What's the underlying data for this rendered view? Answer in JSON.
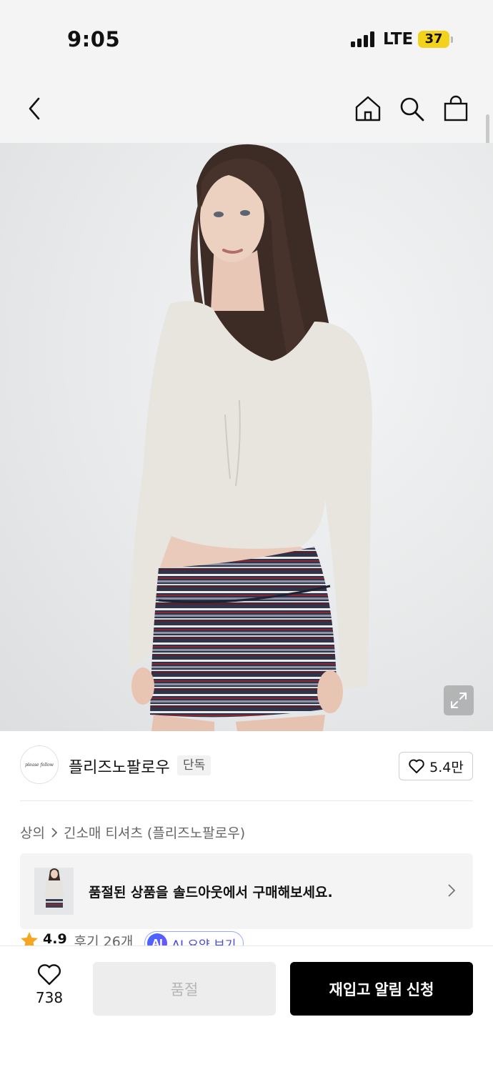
{
  "status_bar": {
    "time": "9:05",
    "network": "LTE",
    "battery": "37",
    "battery_color": "#f2d21b"
  },
  "nav": {
    "icons": [
      "back-chevron-icon",
      "home-icon",
      "search-icon",
      "shopping-bag-icon"
    ]
  },
  "product": {
    "image_icon": "expand-icon"
  },
  "brand": {
    "logo_text": "please follow",
    "name": "플리즈노팔로우",
    "exclusive_tag": "단독",
    "likes": "5.4만"
  },
  "breadcrumb": {
    "category": "상의",
    "subcategory": "긴소매 티셔츠 (플리즈노팔로우)"
  },
  "soldout_banner": {
    "text": "품절된 상품을 솔드아웃에서 구매해보세요."
  },
  "rating": {
    "score": "4.9",
    "review_label": "후기 26개",
    "star_color": "#f5a623"
  },
  "ai_summary": {
    "badge": "AI",
    "label": "AI 요약 보기"
  },
  "bottom_bar": {
    "wish_count": "738",
    "soldout_label": "품절",
    "restock_label": "재입고 알림 신청"
  }
}
